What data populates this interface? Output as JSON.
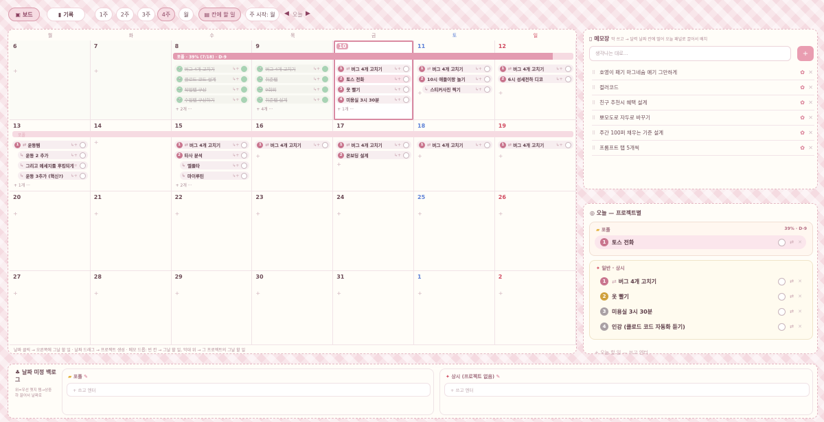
{
  "toolbar": {
    "board": "보드",
    "record": "기록",
    "views": [
      "1주",
      "2주",
      "3주",
      "4주",
      "월"
    ],
    "today_task": "칸에 할 일",
    "week_start": "주 시작: 월",
    "today": "오늘",
    "prev": "◀",
    "next": "▶"
  },
  "calendar": {
    "weekdays": [
      "월",
      "화",
      "수",
      "목",
      "금",
      "토",
      "일"
    ],
    "weeks": [
      [
        "6",
        "7",
        "8",
        "9",
        "10",
        "11",
        "12"
      ],
      [
        "13",
        "14",
        "15",
        "16",
        "17",
        "18",
        "19"
      ],
      [
        "20",
        "21",
        "22",
        "23",
        "24",
        "25",
        "26"
      ],
      [
        "27",
        "28",
        "29",
        "30",
        "31",
        "1",
        "2"
      ]
    ],
    "project_bar": "포폴 · 39% (7/18) · D-9",
    "project_bar_progress": 0.95,
    "project_bar2": "포폴",
    "week1": {
      "wed": [
        {
          "t": "버그 4개 고치기",
          "d": true
        },
        {
          "t": "클로드 코드 설계",
          "d": true
        },
        {
          "t": "작업랩 구상",
          "d": true
        },
        {
          "t": "수업랩 구상하기",
          "d": true
        }
      ],
      "wed_more": "+ 2개 ···",
      "thu": [
        {
          "t": "버그 4개 고치기",
          "d": true
        },
        {
          "t": "취준랩",
          "d": true
        },
        {
          "t": "9회의",
          "d": true
        },
        {
          "t": "취준랩 설계",
          "d": true
        }
      ],
      "thu_more": "+ 4개 ···",
      "fri": [
        {
          "n": "1",
          "t": "버그 4개 고치기"
        },
        {
          "n": "2",
          "t": "토스 전화"
        },
        {
          "n": "3",
          "t": "옷 빨기"
        },
        {
          "n": "4",
          "t": "미용실 3시 30분"
        }
      ],
      "fri_more": "+ 1개 ···",
      "sat": [
        {
          "n": "1",
          "t": "버그 4개 고치기"
        },
        {
          "n": "2",
          "t": "10시 애들이랑 놀기"
        },
        {
          "t": "스티커사진 찍기"
        }
      ],
      "sun": [
        {
          "n": "1",
          "t": "버그 4개 고치기"
        },
        {
          "n": "2",
          "t": "6시 성세전하 디코"
        }
      ]
    },
    "week2": {
      "mon": [
        {
          "n": "1",
          "t": "운동템"
        },
        {
          "t": "운동 2 추가"
        },
        {
          "t": "그리고 메세지를 후킹되게"
        },
        {
          "t": "운동 3추가 (혁신?)"
        }
      ],
      "mon_more": "+ 1개 ···",
      "wed": [
        {
          "n": "1",
          "t": "버그 4개 고치기"
        },
        {
          "n": "2",
          "t": "타사 분석"
        },
        {
          "t": "엘플타"
        },
        {
          "t": "마이루틴"
        }
      ],
      "wed_more": "+ 2개 ···",
      "thu": [
        {
          "n": "1",
          "t": "버그 4개 고치기"
        }
      ],
      "fri": [
        {
          "n": "1",
          "t": "버그 4개 고치기"
        },
        {
          "n": "2",
          "t": "온보딩 설계"
        }
      ],
      "sat": [
        {
          "n": "1",
          "t": "버그 4개 고치기"
        }
      ],
      "sun": [
        {
          "n": "1",
          "t": "버그 4개 고치기"
        }
      ]
    },
    "footer_hint": "날짜 클릭 → 오른쪽에 그날 할 일 · 날짜 드래그 → 프로젝트 생성 · 메모 드롭: 빈 칸 → 그날 할 일, 막대 위 → 그 프로젝트의 그날 할 일"
  },
  "memo": {
    "title": "메모장",
    "hint": "막 쓰고 → 달력 날짜 칸에 떨어 오늘 패널로 끌어서 배치",
    "placeholder": "생각나는 대로...",
    "add": "+",
    "items": [
      "호영이 패기 마그네슘 얘기 그만하게",
      "컬러코드",
      "친구 추천시 혜택 설계",
      "뽀모도로 자두로 바꾸기",
      "주간 100퍼 채우는 기준 설계",
      "프롬프트 탭 5개씩"
    ]
  },
  "today": {
    "title": "오늘 — 프로젝트별",
    "project": "포폴",
    "project_stat": "39% · D-9",
    "project_tasks": [
      {
        "n": "1",
        "t": "토스 전화"
      }
    ],
    "general": "일반 · 상시",
    "general_tasks": [
      {
        "n": "1",
        "t": "버그 4개 고치기",
        "c": "#c9758e"
      },
      {
        "n": "2",
        "t": "옷 빨기",
        "c": "#d0a13e"
      },
      {
        "n": "3",
        "t": "미용실 3시 30분",
        "c": "#a9a0a4"
      },
      {
        "n": "4",
        "t": "인강 (클로드 코드 자동화 듣기)",
        "c": "#a9a0a4"
      }
    ],
    "footer": "+ 오늘 할 일 — 쓰고 엔터"
  },
  "backlog": {
    "title": "날짜 미정 백로그",
    "hint": "위=우선 옛지 템→상중하 끌어서 날짜로",
    "col1": "포폴",
    "col1_input": "+ 쓰고 엔터",
    "col2": "상시 (프로젝트 없음)",
    "col2_input": "+ 쓰고 엔터"
  },
  "colors": {
    "accent": "#c9758e",
    "sat": "#5b7fd6",
    "sun": "#d0495f"
  }
}
